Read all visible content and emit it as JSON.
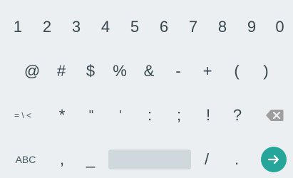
{
  "keyboard": {
    "row1": [
      "1",
      "2",
      "3",
      "4",
      "5",
      "6",
      "7",
      "8",
      "9",
      "0"
    ],
    "row2": [
      "@",
      "#",
      "$",
      "%",
      "&",
      "-",
      "+",
      "(",
      ")"
    ],
    "row3": {
      "more_symbols": "= \\ <",
      "keys": [
        "*",
        "\"",
        "'",
        ":",
        ";",
        "!",
        "?"
      ],
      "delete_icon": "backspace-icon"
    },
    "row4": {
      "abc": "ABC",
      "comma": ",",
      "underscore": "_",
      "slash": "/",
      "period": ".",
      "enter_icon": "arrow-right-icon"
    },
    "colors": {
      "background": "#eceff1",
      "key_text": "#37474f",
      "spacebar": "#cfd8dc",
      "delete_key": "#9e9e9e",
      "enter_accent": "#26a69a"
    }
  }
}
